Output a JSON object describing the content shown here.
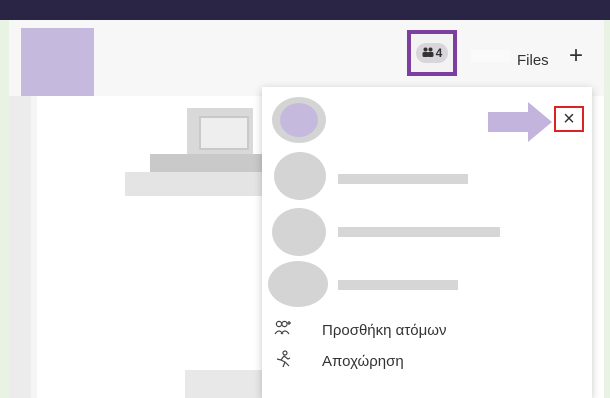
{
  "header": {
    "participants_count": "4",
    "files_tab_label": "Files",
    "add_tab_label": "+"
  },
  "panel": {
    "close_label": "×",
    "menu": [
      {
        "label": "Προσθήκη ατόμων",
        "icon": "add-people-icon"
      },
      {
        "label": "Αποχώρηση",
        "icon": "leave-icon"
      }
    ]
  },
  "colors": {
    "title_bar": "#2a2545",
    "highlight_purple": "#7c3fa0",
    "avatar_lilac": "#c5b9de",
    "arrow_lilac": "#c3b4dd",
    "close_highlight": "#dd2222"
  }
}
